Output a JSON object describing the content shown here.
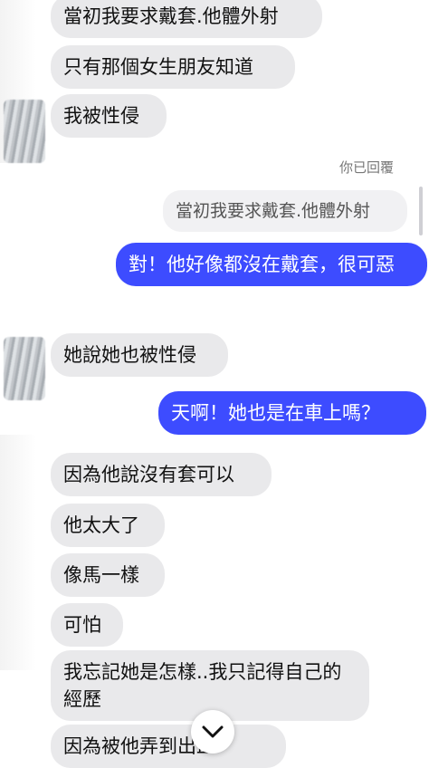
{
  "messages": {
    "m1": "當初我要求戴套.他體外射",
    "m2": "只有那個女生朋友知道",
    "m3": "我被性侵",
    "reply_label": "你已回覆",
    "reply_quote": "當初我要求戴套.他體外射",
    "m4": "對！他好像都沒在戴套，很可惡",
    "m5": "她說她也被性侵",
    "m6": "天啊！她也是在車上嗎？",
    "m7": "因為他說沒有套可以",
    "m8": "他太大了",
    "m9": "像馬一樣",
    "m10": "可怕",
    "m11": "我忘記她是怎樣..我只記得自己的經歷",
    "m12": "因為被他弄到出血"
  },
  "icons": {
    "scroll_down": "chevron-down-icon"
  },
  "colors": {
    "incoming_bubble": "#e9e9eb",
    "outgoing_bubble": "#3d4cff"
  }
}
